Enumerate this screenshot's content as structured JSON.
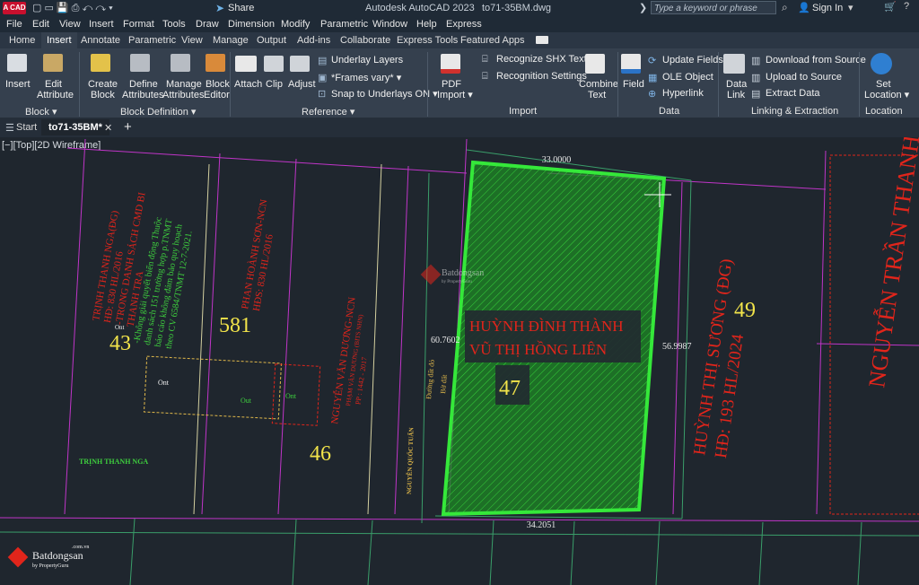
{
  "titlebar": {
    "app_logo": "A CAD",
    "share_label": "Share",
    "app_title": "Autodesk AutoCAD 2023",
    "file_title": "to71-35BM.dwg",
    "search_placeholder": "Type a keyword or phrase",
    "sign_in": "Sign In"
  },
  "menu": [
    "File",
    "Edit",
    "View",
    "Insert",
    "Format",
    "Tools",
    "Draw",
    "Dimension",
    "Modify",
    "Parametric",
    "Window",
    "Help",
    "Express"
  ],
  "ribbon_tabs": [
    "Home",
    "Insert",
    "Annotate",
    "Parametric",
    "View",
    "Manage",
    "Output",
    "Add-ins",
    "Collaborate",
    "Express Tools",
    "Featured Apps"
  ],
  "active_tab": "Insert",
  "ribbon": {
    "insert": "Insert",
    "edit_attribute_1": "Edit",
    "edit_attribute_2": "Attribute",
    "create_block_1": "Create",
    "create_block_2": "Block",
    "define_attributes_1": "Define",
    "define_attributes_2": "Attributes",
    "manage_attributes_1": "Manage",
    "manage_attributes_2": "Attributes",
    "block_editor_1": "Block",
    "block_editor_2": "Editor",
    "attach": "Attach",
    "clip": "Clip",
    "adjust": "Adjust",
    "underlay_layers": "Underlay Layers",
    "frames_vary": "*Frames vary*",
    "snap_to_underlays": "Snap to Underlays ON",
    "pdf_import_1": "PDF",
    "pdf_import_2": "Import",
    "recognize_shx": "Recognize SHX Text",
    "recognition_settings": "Recognition Settings",
    "combine_text_1": "Combine",
    "combine_text_2": "Text",
    "field": "Field",
    "update_fields": "Update Fields",
    "ole_object": "OLE Object",
    "hyperlink": "Hyperlink",
    "data_link_1": "Data",
    "data_link_2": "Link",
    "download_from_source": "Download from Source",
    "upload_to_source": "Upload to Source",
    "extract_data": "Extract  Data",
    "set_location_1": "Set",
    "set_location_2": "Location",
    "groups": [
      "Block",
      "Block Definition",
      "Reference",
      "Import",
      "Data",
      "Linking & Extraction",
      "Location"
    ]
  },
  "doc_tabs": {
    "start": "Start",
    "active": "to71-35BM*"
  },
  "viewport_label": "[−][Top][2D Wireframe]",
  "drawing": {
    "dim_top": "33.0000",
    "dim_bottom": "34.2051",
    "dim_left": "60.7602",
    "dim_right": "56.9987",
    "owner_line1": "HUỲNH ĐÌNH THÀNH",
    "owner_line2": "VŨ THỊ HỒNG LIÊN",
    "lot_47": "47",
    "lot_43": "43",
    "lot_581": "581",
    "lot_46": "46",
    "lot_49": "49",
    "left_red_text": [
      "TRỊNH THANH NGA(ĐG)",
      "HĐ: 830 HL/2016",
      "-TRONG DANH SÁCH CMD BI",
      "THANH TRA"
    ],
    "left_green_text": [
      "-Không giải quyết biến động Thuộc",
      "danh sách 151 trường hợp p.TNMT",
      "báo cáo không đảm bảo quy hoạch",
      "theo CV 6584/TNMT 12-7-2021."
    ],
    "phan_hoanh": [
      "PHAN HOÀNH SƠN-NCN",
      "HĐS: 830 HL/2016"
    ],
    "nguyen_van_duong": "NGUYỄN VĂN DƯƠNG-NCN",
    "pham_van_duong": "PHẠM VĂN DƯƠNG (BITS NHN)",
    "pp_number": "PP : 1442 - 2017",
    "road_label": "Đường đất đỏ",
    "bo_dat": "Bờ đất",
    "nguyen_quoc_tuan": "NGUYỄN QUỐC TUẤN",
    "trinh_thanh_nga": "TRỊNH THANH NGA",
    "huynh_thi_suong": "HUỲNH THỊ SƯƠNG (ĐG)",
    "hd_193": "HĐ: 193 HL/2024",
    "nguyen_tran_thanh": "NGUYỄN TRẦN THANH",
    "ont": "Ont",
    "out": "Out",
    "watermark_main": "Batdongsan",
    "watermark_sub": "by PropertyGuru",
    "watermark_com": ".com.vn"
  },
  "colors": {
    "accent_green": "#35e83a",
    "hatch_green": "#1e8a24",
    "cad_red": "#e1251b",
    "cad_yellow": "#f2e44a",
    "cad_magenta": "#c035c8",
    "cad_green_text": "#3ecf3e"
  }
}
